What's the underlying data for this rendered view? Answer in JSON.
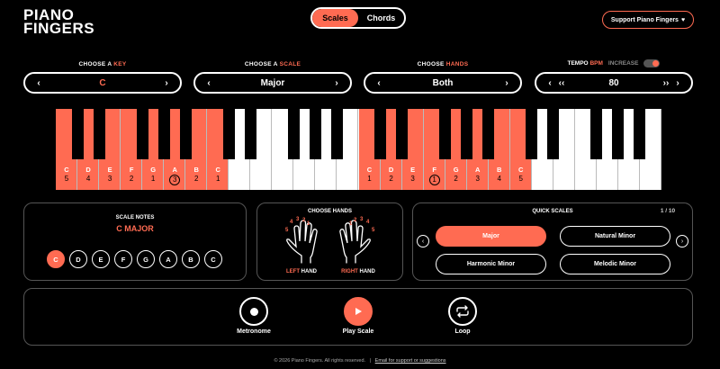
{
  "header": {
    "logo_line1": "PIANO",
    "logo_line2": "FINGERS",
    "tabs": [
      "Scales",
      "Chords"
    ],
    "support_label": "Support Piano Fingers",
    "support_icon": "heart-icon"
  },
  "controls": {
    "key": {
      "label_prefix": "CHOOSE A",
      "label_accent": "KEY",
      "value": "C"
    },
    "scale": {
      "label_prefix": "CHOOSE A",
      "label_accent": "SCALE",
      "value": "Major"
    },
    "hands": {
      "label_prefix": "CHOOSE",
      "label_accent": "HANDS",
      "value": "Both"
    },
    "tempo": {
      "label_prefix": "TEMPO",
      "label_accent": "BPM",
      "increase_label": "INCREASE",
      "value": "80",
      "dec": "‹‹",
      "inc": "››"
    }
  },
  "keyboard": {
    "left_hand": [
      {
        "note": "C",
        "finger": "5",
        "circled": false
      },
      {
        "note": "D",
        "finger": "4",
        "circled": false
      },
      {
        "note": "E",
        "finger": "3",
        "circled": false
      },
      {
        "note": "F",
        "finger": "2",
        "circled": false
      },
      {
        "note": "G",
        "finger": "1",
        "circled": false
      },
      {
        "note": "A",
        "finger": "3",
        "circled": true
      },
      {
        "note": "B",
        "finger": "2",
        "circled": false
      },
      {
        "note": "C",
        "finger": "1",
        "circled": false
      }
    ],
    "right_hand": [
      {
        "note": "C",
        "finger": "1",
        "circled": false
      },
      {
        "note": "D",
        "finger": "2",
        "circled": false
      },
      {
        "note": "E",
        "finger": "3",
        "circled": false
      },
      {
        "note": "F",
        "finger": "1",
        "circled": true
      },
      {
        "note": "G",
        "finger": "2",
        "circled": false
      },
      {
        "note": "A",
        "finger": "3",
        "circled": false
      },
      {
        "note": "B",
        "finger": "4",
        "circled": false
      },
      {
        "note": "C",
        "finger": "5",
        "circled": false
      }
    ]
  },
  "scale_notes": {
    "title": "SCALE NOTES",
    "scale_name": "C MAJOR",
    "notes": [
      "C",
      "D",
      "E",
      "F",
      "G",
      "A",
      "B",
      "C"
    ]
  },
  "choose_hands": {
    "title": "CHOOSE HANDS",
    "left_accent": "LEFT",
    "right_accent": "RIGHT",
    "hand_word": "HAND",
    "left_fingers": [
      "5",
      "4",
      "3",
      "2",
      "1"
    ],
    "right_fingers": [
      "1",
      "2",
      "3",
      "4",
      "5"
    ]
  },
  "quick_scales": {
    "title": "QUICK SCALES",
    "page": "1 / 10",
    "items": [
      "Major",
      "Natural Minor",
      "Harmonic Minor",
      "Melodic Minor"
    ],
    "active": "Major"
  },
  "player": {
    "metronome_label": "Metronome",
    "play_label": "Play Scale",
    "loop_label": "Loop"
  },
  "footer": {
    "copyright": "© 2026 Piano Fingers. All rights reserved.",
    "link": "Email for support or suggestions",
    "separator": "|"
  },
  "colors": {
    "accent": "#ff6b52",
    "background": "#000000"
  }
}
